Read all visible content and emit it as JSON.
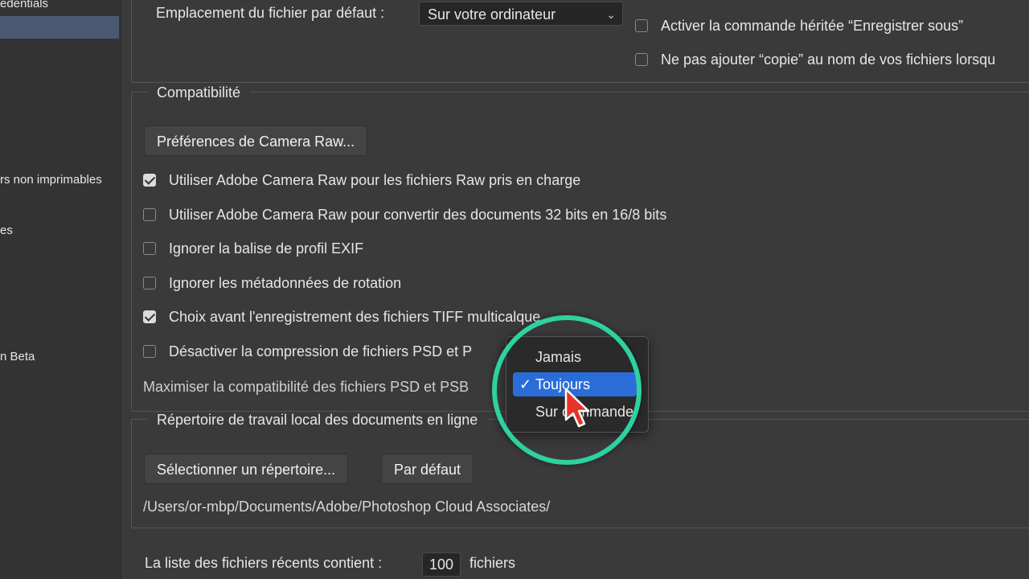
{
  "sidebar": {
    "items": [
      {
        "label": "edentials"
      },
      {
        "label": "rs non imprimables"
      },
      {
        "label": "es"
      },
      {
        "label": "n Beta"
      }
    ]
  },
  "file_location": {
    "label": "Emplacement du fichier par défaut :",
    "value": "Sur votre ordinateur"
  },
  "top_options": [
    {
      "label": "Activer la commande héritée “Enregistrer sous”",
      "checked": false
    },
    {
      "label": "Ne pas ajouter “copie” au nom de vos fichiers lorsqu",
      "checked": false
    }
  ],
  "compat": {
    "legend": "Compatibilité",
    "camera_raw_button": "Préférences de Camera Raw...",
    "options": [
      {
        "label": "Utiliser Adobe Camera Raw pour les fichiers Raw pris en charge",
        "checked": true
      },
      {
        "label": "Utiliser Adobe Camera Raw pour convertir des documents 32 bits en 16/8 bits",
        "checked": false
      },
      {
        "label": "Ignorer la balise de profil EXIF",
        "checked": false
      },
      {
        "label": "Ignorer les métadonnées de rotation",
        "checked": false
      },
      {
        "label": "Choix avant l'enregistrement des fichiers TIFF multicalque",
        "checked": true
      },
      {
        "label": "Désactiver la compression de fichiers PSD et P",
        "checked": false
      }
    ],
    "maximize_label": "Maximiser la compatibilité des fichiers PSD et PSB"
  },
  "dropdown": {
    "options": [
      "Jamais",
      "Toujours",
      "Sur commande"
    ],
    "selected": "Toujours",
    "check_glyph": "✓"
  },
  "work_dir": {
    "legend": "Répertoire de travail local des documents en ligne",
    "select_button": "Sélectionner un répertoire...",
    "default_button": "Par défaut",
    "path": "/Users/or-mbp/Documents/Adobe/Photoshop Cloud Associates/"
  },
  "recent": {
    "label": "La liste des fichiers récents contient :",
    "value": "100",
    "suffix": "fichiers"
  },
  "colors": {
    "accent": "#2a6dd9",
    "highlight_ring": "#2ed1a0",
    "cursor": "#e8322a"
  },
  "icons": {
    "cursor": "pointer-hand-icon",
    "chevron": "chevron-up-down-icon"
  }
}
